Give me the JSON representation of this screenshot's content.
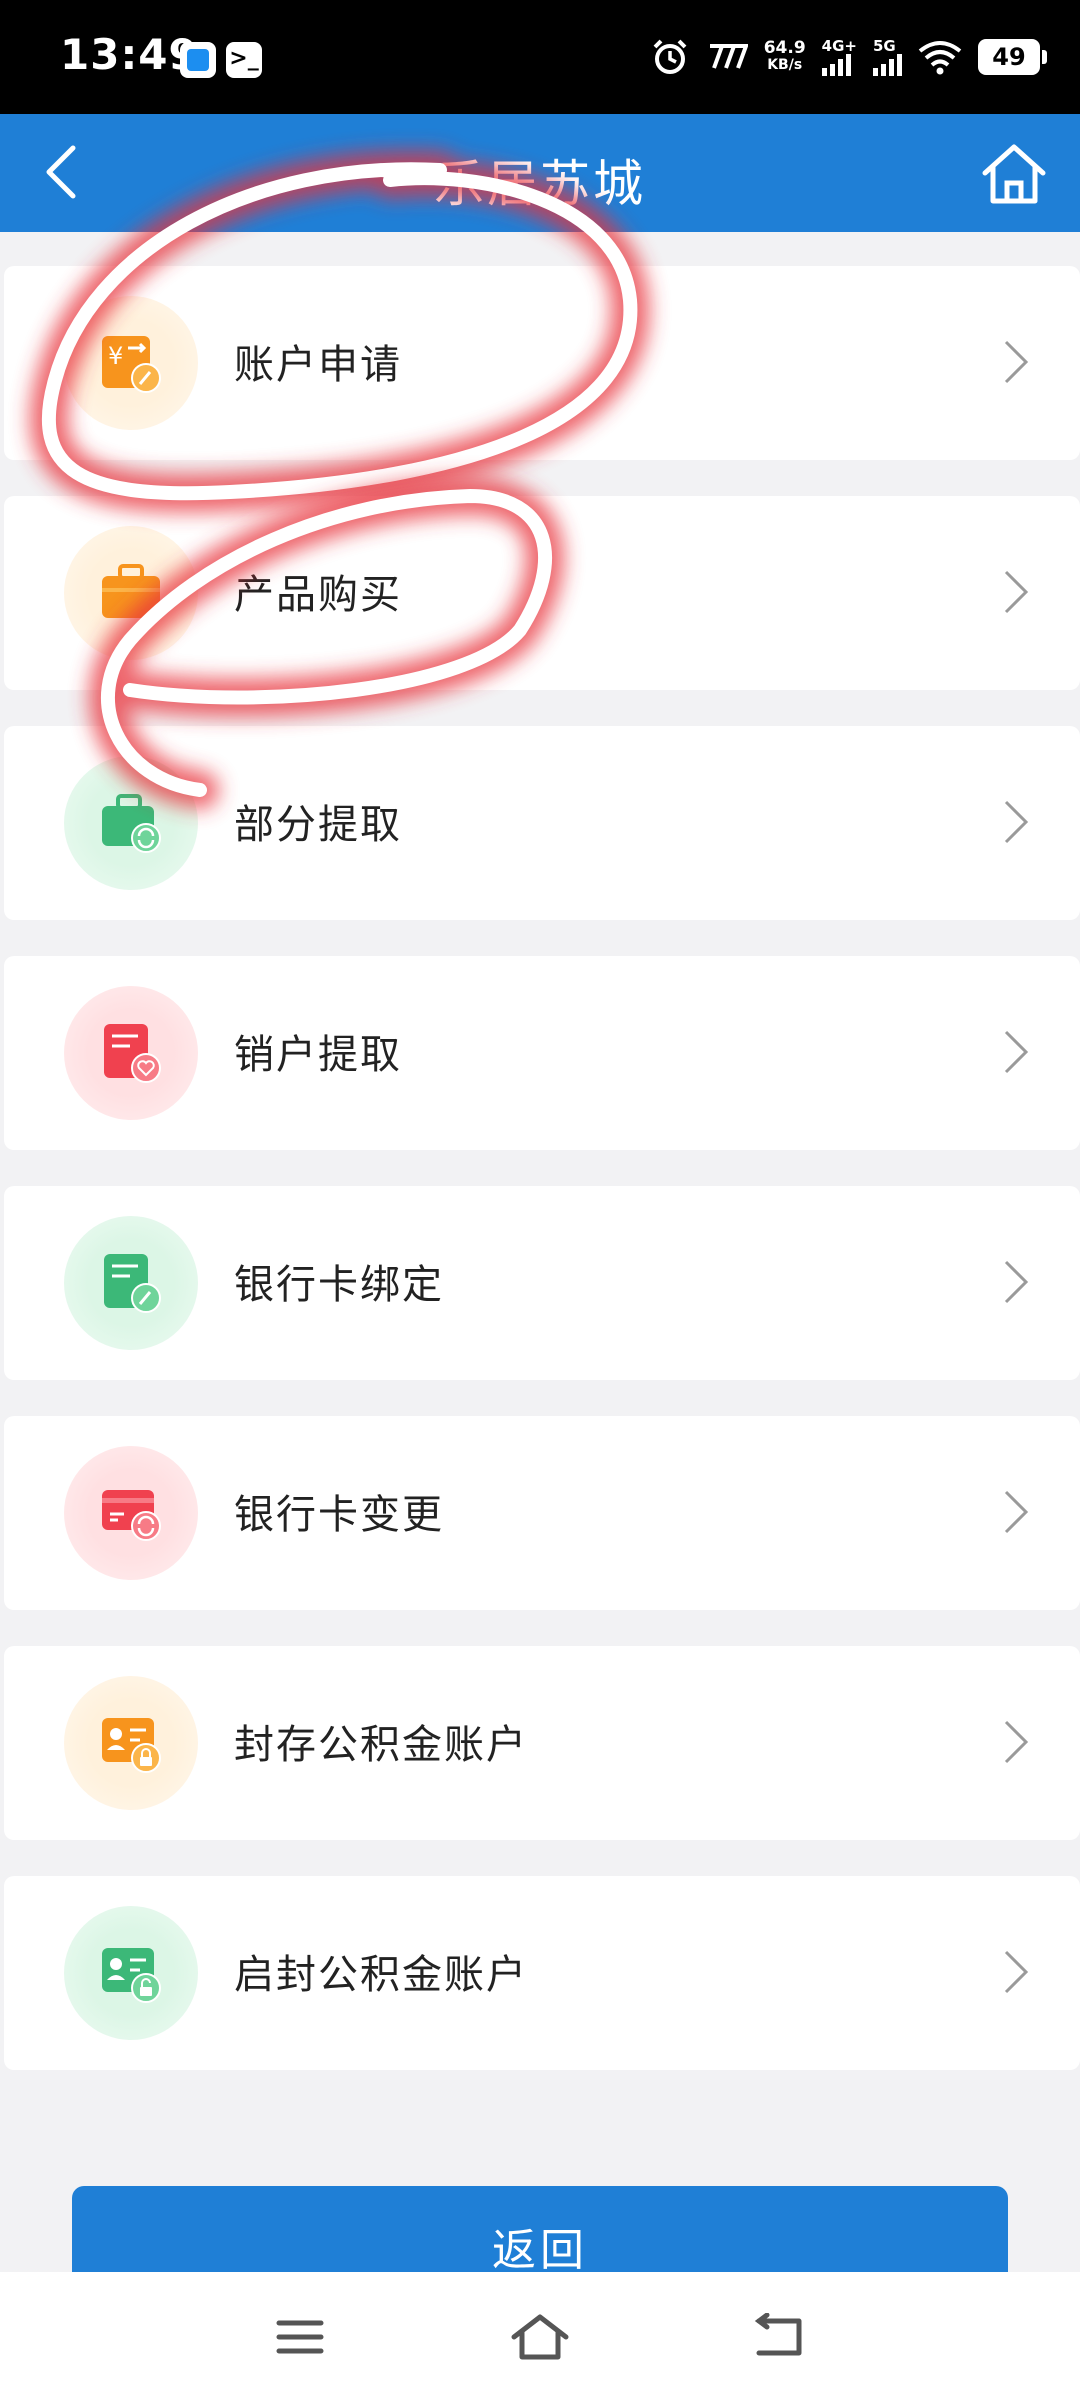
{
  "status_bar": {
    "time": "13:49",
    "app2_glyph": ">_",
    "speed_value": "64.9",
    "speed_unit": "KB/s",
    "net_4g": "4G+",
    "net_5g": "5G",
    "battery": "49"
  },
  "header": {
    "title": "乐居苏城",
    "back_icon": "chevron-left-icon",
    "home_icon": "home-icon"
  },
  "menu": [
    {
      "label": "账户申请",
      "icon": "yuan-edit-icon",
      "color": "#f7941d"
    },
    {
      "label": "产品购买",
      "icon": "briefcase-icon",
      "color": "#f7941d"
    },
    {
      "label": "部分提取",
      "icon": "briefcase-refresh-icon",
      "color": "#3cb878"
    },
    {
      "label": "销户提取",
      "icon": "document-heart-icon",
      "color": "#f0414f"
    },
    {
      "label": "银行卡绑定",
      "icon": "card-edit-icon",
      "color": "#3cb878"
    },
    {
      "label": "银行卡变更",
      "icon": "card-refresh-icon",
      "color": "#f0414f"
    },
    {
      "label": "封存公积金账户",
      "icon": "id-lock-icon",
      "color": "#f7941d"
    },
    {
      "label": "启封公积金账户",
      "icon": "id-unlock-icon",
      "color": "#3cb878"
    }
  ],
  "return_button": {
    "label": "返回"
  },
  "colors": {
    "header_blue": "#1f7fd6",
    "annotation_red": "#e8303a"
  }
}
